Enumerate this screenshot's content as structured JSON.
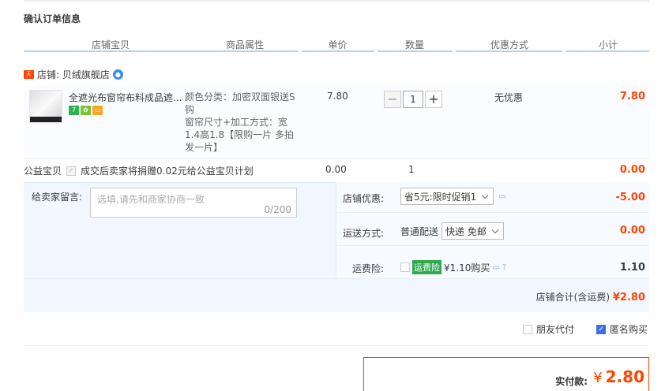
{
  "title": "确认订单信息",
  "headers": [
    "店铺宝贝",
    "商品属性",
    "单价",
    "数量",
    "优惠方式",
    "小计"
  ],
  "shop": {
    "badge": "天猫",
    "label": "店铺: 贝绒旗舰店",
    "ww_icon": "wangwang-icon"
  },
  "item": {
    "name": "全遮光布窗帘布料成品遮...",
    "attrs": "颜色分类：加密双面银送S钩\n窗帘尺寸+加工方式：宽1.4高1.8【限购一片 多拍发一片】",
    "price": "7.80",
    "qty": "1",
    "minus": "−",
    "plus": "+",
    "promo": "无优惠",
    "subtotal": "7.80"
  },
  "welfare": {
    "label": "公益宝贝",
    "check": "✓",
    "desc": "成交后卖家将捐赠0.02元给公益宝贝计划",
    "price": "0.00",
    "qty": "1",
    "subtotal": "0.00"
  },
  "message": {
    "label": "给卖家留言:",
    "placeholder": "选填,请先和商家协商一致",
    "count": "0/200"
  },
  "shop_discount": {
    "label": "店铺优惠:",
    "selected": "省5元:限时促销1",
    "value": "-5.00"
  },
  "shipping": {
    "label": "运送方式:",
    "method": "普通配送",
    "selected": "快递 免邮",
    "value": "0.00"
  },
  "insurance": {
    "label": "运费险:",
    "badge": "运费险",
    "price": "¥1.10购买",
    "value": "1.10"
  },
  "shop_total": {
    "label": "店铺合计(含运费)",
    "value": "¥2.80"
  },
  "options": {
    "friend_pay": "朋友代付",
    "anonymous": "匿名购买",
    "check": "✓"
  },
  "pay": {
    "label": "实付款:",
    "yen": "¥",
    "value": "2.80"
  }
}
